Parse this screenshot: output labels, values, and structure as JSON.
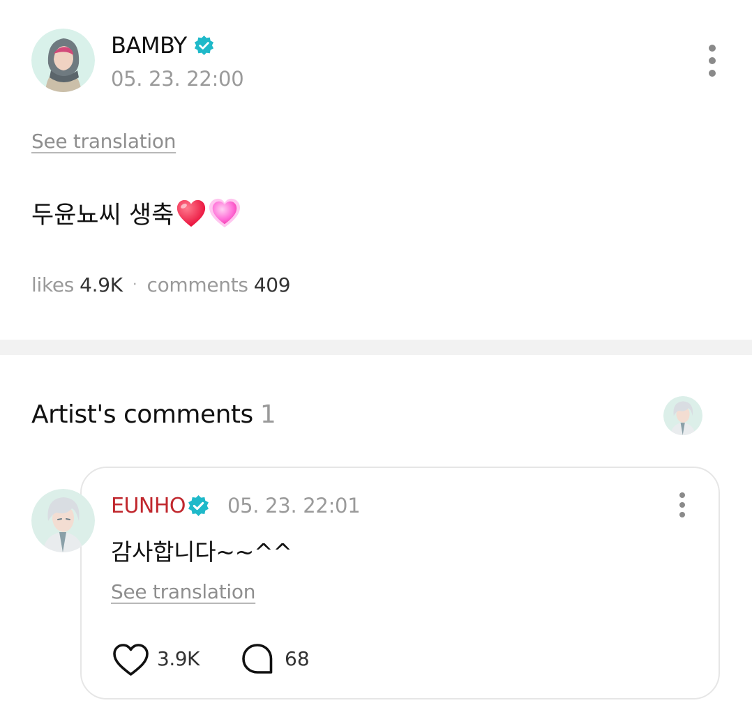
{
  "post": {
    "author": "BAMBY",
    "time": "05. 23. 22:00",
    "see_translation": "See translation",
    "body": "두윤뇨씨 생축",
    "likes_label": "likes",
    "likes_value": "4.9K",
    "separator": "·",
    "comments_label": "comments",
    "comments_value": "409"
  },
  "artist_comments": {
    "title": "Artist's comments",
    "count": "1"
  },
  "comment": {
    "author": "EUNHO",
    "time": "05. 23. 22:01",
    "body": "감사합니다~~^^",
    "see_translation": "See translation",
    "likes": "3.9K",
    "replies": "68"
  },
  "colors": {
    "verified_badge": "#1fb9c9",
    "artist_name": "#c0272d",
    "heart_red": "#ff2a55",
    "heart_pink": "#ff5fd2"
  },
  "icons": {
    "verified": "verified-badge-icon",
    "menu": "vertical-ellipsis-icon",
    "like": "heart-outline-icon",
    "reply": "speech-bubble-icon"
  }
}
